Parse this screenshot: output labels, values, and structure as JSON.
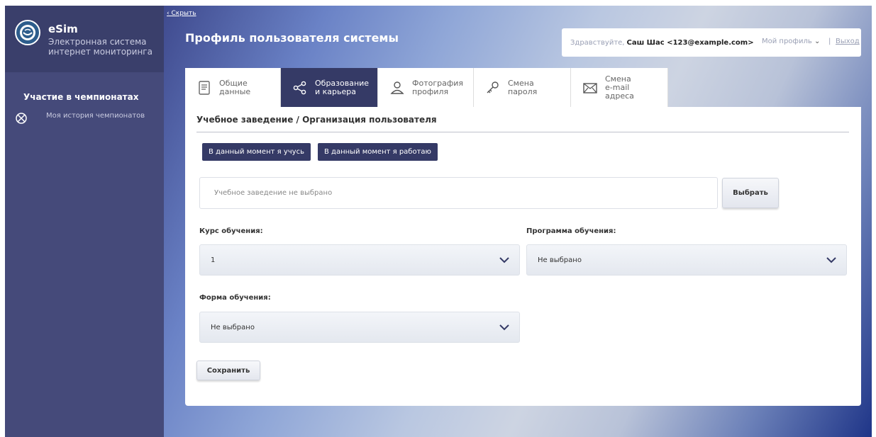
{
  "sidebar": {
    "brand_title": "eSim",
    "brand_subtitle_line1": "Электронная система",
    "brand_subtitle_line2": "интернет мониторинга",
    "section_title": "Участие в чемпионатах",
    "history_link": "Моя история чемпионатов"
  },
  "header": {
    "hide_link": "Скрыть",
    "page_title": "Профиль пользователя системы",
    "greeting": "Здравствуйте,",
    "user_name": "Саш Шас <123@example.com>",
    "my_profile": "Мой профиль",
    "separator": "|",
    "logout": "Выход"
  },
  "tabs": [
    {
      "line1": "Общие",
      "line2": "данные",
      "icon": "document-icon"
    },
    {
      "line1": "Образование",
      "line2": "и карьера",
      "icon": "share-icon"
    },
    {
      "line1": "Фотография",
      "line2": "профиля",
      "icon": "user-photo-icon"
    },
    {
      "line1": "Смена",
      "line2": "пароля",
      "icon": "key-icon"
    },
    {
      "line1": "Смена",
      "line2": "e-mail",
      "line3": "адреса",
      "icon": "envelope-icon"
    }
  ],
  "form": {
    "section_title": "Учебное заведение / Организация пользователя",
    "study_button": "В данный момент я учусь",
    "work_button": "В данный момент я работаю",
    "institution_placeholder": "Учебное заведение не выбрано",
    "choose_button": "Выбрать",
    "course_label": "Курс обучения:",
    "course_value": "1",
    "program_label": "Программа обучения:",
    "program_value": "Не выбрано",
    "form_label": "Форма обучения:",
    "form_value": "Не выбрано",
    "save_button": "Сохранить"
  },
  "colors": {
    "sidebar": "#454a7a",
    "active_tab": "#353a66",
    "accent_button": "#353a66"
  }
}
